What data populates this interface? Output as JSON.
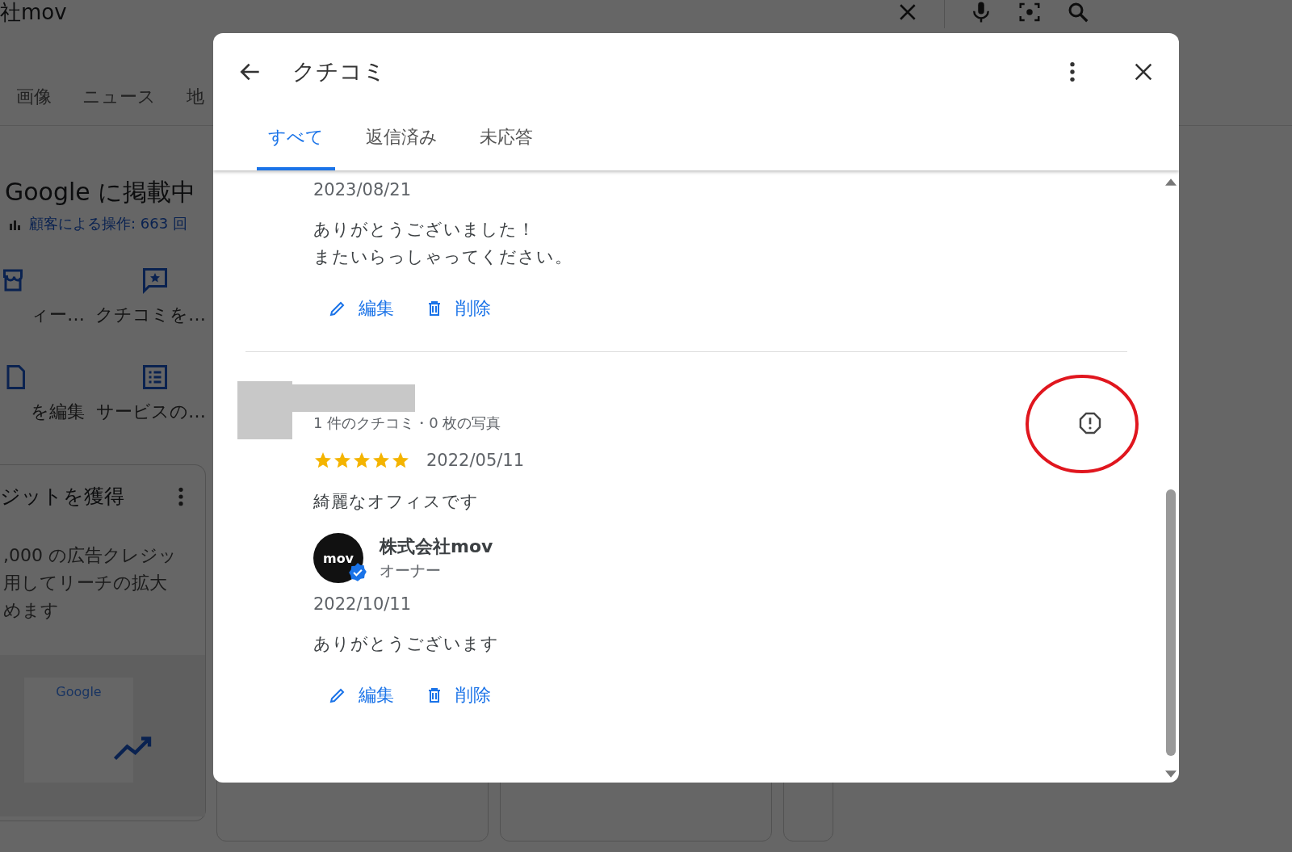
{
  "search_bar": {
    "query": "社mov"
  },
  "background_tabs": [
    "画像",
    "ニュース",
    "地"
  ],
  "business_panel": {
    "title": "Google に掲載中",
    "stat": "顧客による操作: 663 回",
    "actions": [
      {
        "kind": "store",
        "label": "ィー…"
      },
      {
        "kind": "review",
        "label": "クチコミを…"
      },
      {
        "kind": "edit",
        "label": "を編集"
      },
      {
        "kind": "list",
        "label": "サービスの…"
      }
    ],
    "promo": {
      "title": "ジットを獲得",
      "lines": [
        ",000 の広告クレジッ",
        "用してリーチの拡大",
        "めます"
      ],
      "logo": "Google"
    }
  },
  "dialog": {
    "title": "クチコミ",
    "tabs": [
      {
        "label": "すべて",
        "selected": true
      },
      {
        "label": "返信済み",
        "selected": false
      },
      {
        "label": "未応答",
        "selected": false
      }
    ],
    "items": [
      {
        "kind": "reply",
        "date": "2023/08/21",
        "lines": [
          "ありがとうございました！",
          "またいらっしゃってください。"
        ],
        "actions": [
          "編集",
          "削除"
        ]
      },
      {
        "kind": "review",
        "meta": "1 件のクチコミ・0 枚の写真",
        "stars": 5,
        "date": "2022/05/11",
        "text": "綺麗なオフィスです",
        "reply": {
          "avatar": "mov",
          "name": "株式会社mov",
          "role": "オーナー",
          "date": "2022/10/11",
          "text": "ありがとうございます",
          "actions": [
            "編集",
            "削除"
          ]
        }
      }
    ]
  }
}
